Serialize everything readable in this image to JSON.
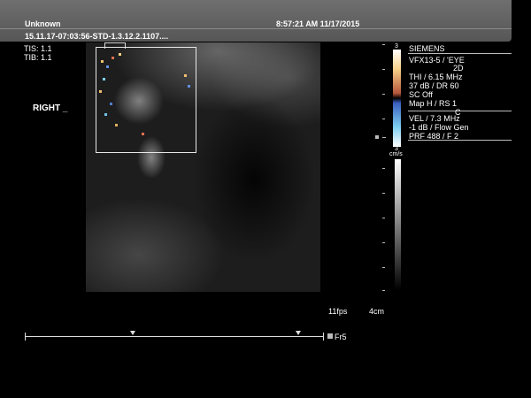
{
  "header": {
    "patient": "Unknown",
    "datetime": "8:57:21 AM 11/17/2015",
    "study_id": "15.11.17-07:03:56-STD-1.3.12.2.1107....",
    "tis": "TIS: 1.1",
    "tib": "TIB: 1.1"
  },
  "image": {
    "side_label": "RIGHT _",
    "frame_rate": "11fps",
    "depth": "4cm",
    "frame": "Fr5"
  },
  "colorbar": {
    "top_label": "3",
    "bottom_label": "3",
    "unit": "cm/s",
    "colors": [
      "#ffffff",
      "#f7d28a",
      "#b4563a",
      "#000000",
      "#3a5fc0",
      "#7fd0f0",
      "#ffffff"
    ]
  },
  "params": {
    "vendor": "SIEMENS",
    "transducer": "VFX13-5 / 'EYE",
    "mode_2d": "2D",
    "thi": "THI / 6.15 MHz",
    "db_dr": "37 dB / DR 60",
    "sc": "SC Off",
    "map": "Map H / RS 1",
    "mode_c": "C",
    "vel": "VEL / 7.3 MHz",
    "flow": "-1 dB / Flow Gen",
    "prf": "PRF 488 / F 2"
  }
}
